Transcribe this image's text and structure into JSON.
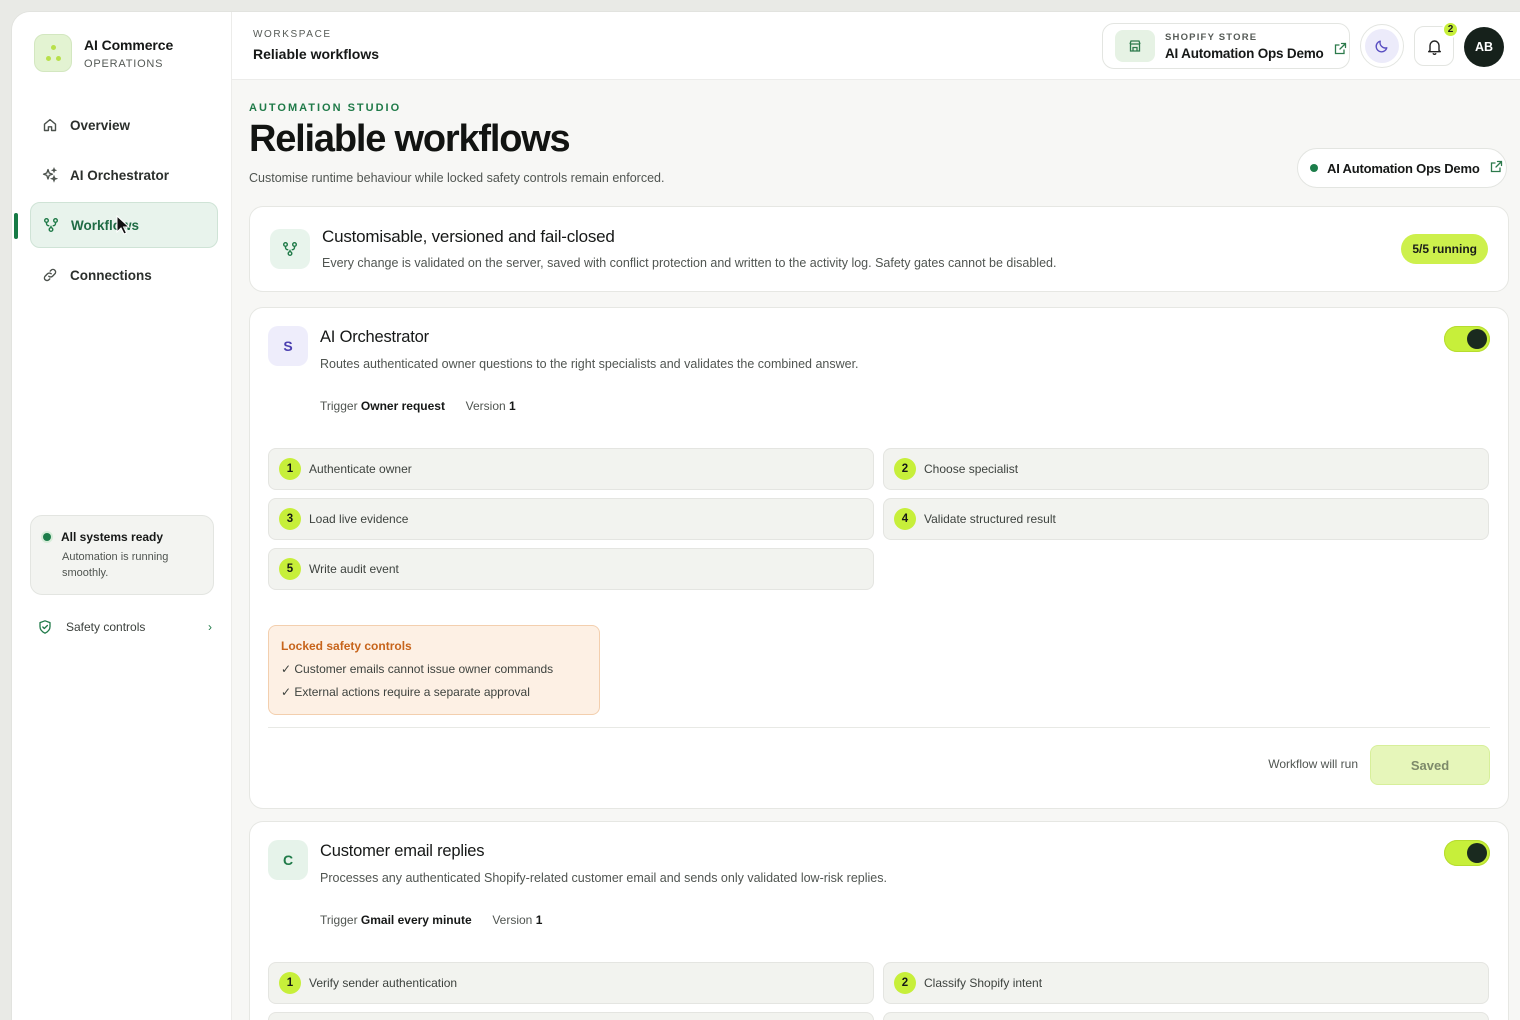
{
  "brand": {
    "name": "AI Commerce",
    "subtitle": "OPERATIONS"
  },
  "sidebar": {
    "items": [
      {
        "label": "Overview",
        "icon": "home-icon"
      },
      {
        "label": "AI Orchestrator",
        "icon": "sparkle-icon"
      },
      {
        "label": "Workflows",
        "icon": "workflow-icon",
        "active": true
      },
      {
        "label": "Connections",
        "icon": "link-icon"
      }
    ],
    "status": {
      "title": "All systems ready",
      "desc": "Automation is running smoothly."
    },
    "safety_link": "Safety controls"
  },
  "header": {
    "workspace_label": "WORKSPACE",
    "workspace_title": "Reliable workflows",
    "store_label": "SHOPIFY STORE",
    "store_name": "AI Automation Ops Demo",
    "notification_count": "2",
    "avatar_initials": "AB"
  },
  "page": {
    "eyebrow": "AUTOMATION STUDIO",
    "title": "Reliable workflows",
    "subtitle": "Customise runtime behaviour while locked safety controls remain enforced.",
    "store_pill": "AI Automation Ops Demo"
  },
  "info_card": {
    "title": "Customisable, versioned and fail-closed",
    "desc": "Every change is validated on the server, saved with conflict protection and written to the activity log. Safety gates cannot be disabled.",
    "badge": "5/5 running"
  },
  "workflows": [
    {
      "avatar": "S",
      "title": "AI Orchestrator",
      "desc": "Routes authenticated owner questions to the right specialists and validates the combined answer.",
      "trigger_label": "Trigger",
      "trigger": "Owner request",
      "version_label": "Version",
      "version": "1",
      "enabled": true,
      "steps": [
        "Authenticate owner",
        "Choose specialist",
        "Load live evidence",
        "Validate structured result",
        "Write audit event"
      ],
      "locked_title": "Locked safety controls",
      "locked_items": [
        "✓ Customer emails cannot issue owner commands",
        "✓ External actions require a separate approval"
      ],
      "run_text": "Workflow will run",
      "save_label": "Saved"
    },
    {
      "avatar": "C",
      "title": "Customer email replies",
      "desc": "Processes any authenticated Shopify-related customer email and sends only validated low-risk replies.",
      "trigger_label": "Trigger",
      "trigger": "Gmail every minute",
      "version_label": "Version",
      "version": "1",
      "enabled": true,
      "steps": [
        "Verify sender authentication",
        "Classify Shopify intent"
      ]
    }
  ],
  "colors": {
    "accent": "#c7ef3a",
    "brand_green": "#1f7a48",
    "warning": "#c7641b"
  }
}
